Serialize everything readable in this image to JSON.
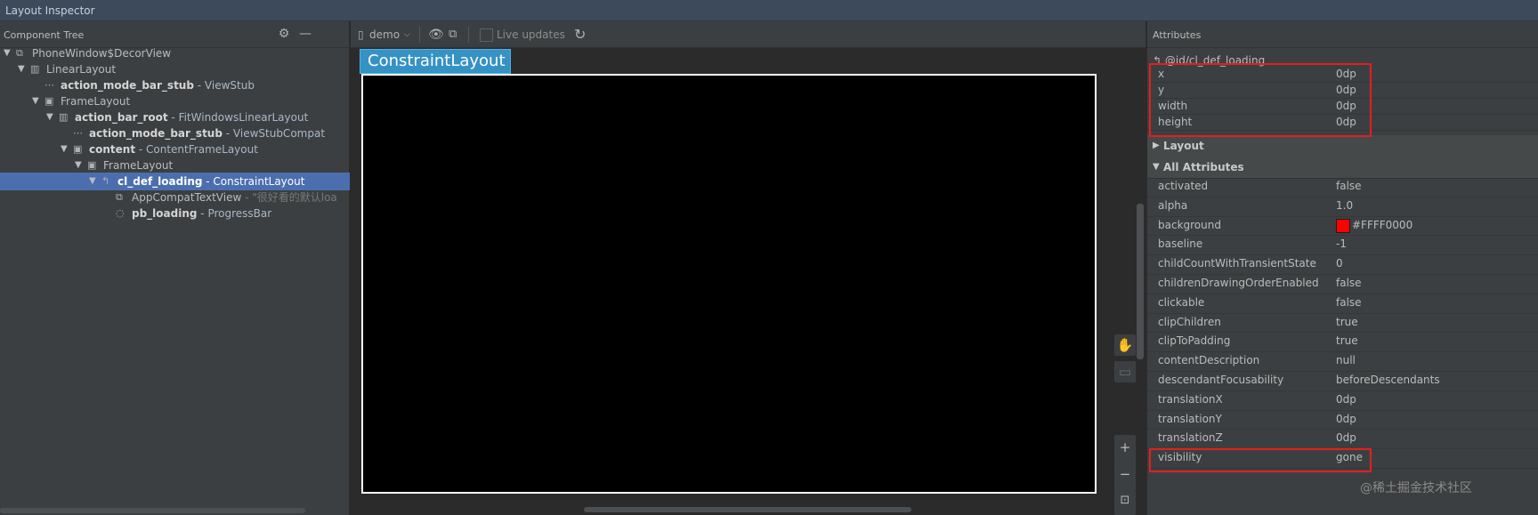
{
  "window": {
    "title": "Layout Inspector"
  },
  "component_tree": {
    "header": "Component Tree",
    "rows": [
      {
        "id": "PhoneWindow$DecorView",
        "cls": "",
        "extra": "",
        "icon": "decor-view-icon",
        "bold": false
      },
      {
        "id": "LinearLayout",
        "cls": "",
        "extra": "",
        "icon": "linear-layout-icon",
        "bold": false
      },
      {
        "id": "action_mode_bar_stub",
        "cls": " - ViewStub",
        "extra": "",
        "icon": "viewstub-icon",
        "bold": true
      },
      {
        "id": "FrameLayout",
        "cls": "",
        "extra": "",
        "icon": "frame-layout-icon",
        "bold": false
      },
      {
        "id": "action_bar_root",
        "cls": " - FitWindowsLinearLayout",
        "extra": "",
        "icon": "linear-layout-icon",
        "bold": true
      },
      {
        "id": "action_mode_bar_stub",
        "cls": " - ViewStubCompat",
        "extra": "",
        "icon": "viewstub-icon",
        "bold": true
      },
      {
        "id": "content",
        "cls": " - ContentFrameLayout",
        "extra": "",
        "icon": "frame-layout-icon",
        "bold": true
      },
      {
        "id": "FrameLayout",
        "cls": "",
        "extra": "",
        "icon": "frame-layout-icon",
        "bold": false
      },
      {
        "id": "cl_def_loading",
        "cls": " - ConstraintLayout",
        "extra": "",
        "icon": "constraint-layout-icon",
        "bold": true
      },
      {
        "id": "AppCompatTextView",
        "cls": "",
        "extra": " - \"很好看的默认loa",
        "icon": "textview-icon",
        "bold": false
      },
      {
        "id": "pb_loading",
        "cls": " - ProgressBar",
        "extra": "",
        "icon": "progressbar-icon",
        "bold": true
      }
    ]
  },
  "toolbar": {
    "process": "demo",
    "live_updates": "Live updates"
  },
  "preview": {
    "selected_label": "ConstraintLayout"
  },
  "attributes": {
    "header": "Attributes",
    "view_id": "@id/cl_def_loading",
    "dimensions": [
      {
        "k": "x",
        "v": "0dp"
      },
      {
        "k": "y",
        "v": "0dp"
      },
      {
        "k": "width",
        "v": "0dp"
      },
      {
        "k": "height",
        "v": "0dp"
      }
    ],
    "section_layout": "Layout",
    "section_all": "All Attributes",
    "all": [
      {
        "k": "activated",
        "v": "false"
      },
      {
        "k": "alpha",
        "v": "1.0"
      },
      {
        "k": "background",
        "v": "#FFFF0000",
        "swatch": "#ff0000"
      },
      {
        "k": "baseline",
        "v": "-1"
      },
      {
        "k": "childCountWithTransientState",
        "v": "0"
      },
      {
        "k": "childrenDrawingOrderEnabled",
        "v": "false"
      },
      {
        "k": "clickable",
        "v": "false"
      },
      {
        "k": "clipChildren",
        "v": "true"
      },
      {
        "k": "clipToPadding",
        "v": "true"
      },
      {
        "k": "contentDescription",
        "v": "null"
      },
      {
        "k": "descendantFocusability",
        "v": "beforeDescendants"
      },
      {
        "k": "translationX",
        "v": "0dp"
      },
      {
        "k": "translationY",
        "v": "0dp"
      },
      {
        "k": "translationZ",
        "v": "0dp"
      },
      {
        "k": "visibility",
        "v": "gone"
      }
    ]
  },
  "watermark": "@稀土掘金技术社区"
}
